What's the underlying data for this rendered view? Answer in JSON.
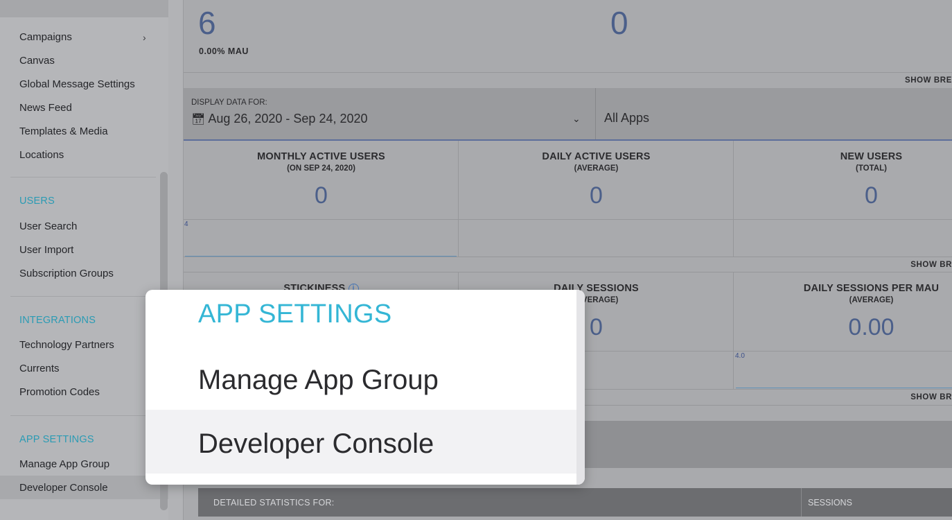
{
  "sidebar": {
    "items_top": [
      {
        "label": "Campaigns",
        "has_submenu": true
      },
      {
        "label": "Canvas"
      },
      {
        "label": "Global Message Settings"
      },
      {
        "label": "News Feed"
      },
      {
        "label": "Templates & Media"
      },
      {
        "label": "Locations"
      }
    ],
    "users_section": "USERS",
    "users_items": [
      "User Search",
      "User Import",
      "Subscription Groups"
    ],
    "integrations_section": "INTEGRATIONS",
    "integrations_items": [
      "Technology Partners",
      "Currents",
      "Promotion Codes"
    ],
    "app_settings_section": "APP SETTINGS",
    "app_settings_items": [
      "Manage App Group",
      "Developer Console"
    ],
    "active_item": "Developer Console",
    "accent_color": "#2a9bb4"
  },
  "top_stats": {
    "left_value": "6",
    "left_sub": "0.00% MAU",
    "right_value": "0",
    "show_breakdown": "SHOW BRE"
  },
  "filter": {
    "label": "DISPLAY DATA FOR:",
    "date_range": "Aug 26, 2020 - Sep 24, 2020",
    "apps": "All Apps"
  },
  "stats_row1": [
    {
      "title": "MONTHLY ACTIVE USERS",
      "sub": "(ON SEP 24, 2020)",
      "value": "0"
    },
    {
      "title": "DAILY ACTIVE USERS",
      "sub": "(AVERAGE)",
      "value": "0"
    },
    {
      "title": "NEW USERS",
      "sub": "(TOTAL)",
      "value": "0"
    }
  ],
  "row1_axis_tick": "4",
  "row1_show_breakdown": "SHOW BR",
  "stats_row2": [
    {
      "title": "STICKINESS",
      "sub": "",
      "value": ""
    },
    {
      "title": "DAILY SESSIONS",
      "sub": "(AVERAGE)",
      "value": "0"
    },
    {
      "title": "DAILY SESSIONS PER MAU",
      "sub": "(AVERAGE)",
      "value": "0.00"
    }
  ],
  "row2_axis_tick": "4.0",
  "row2_show_breakdown": "SHOW BR",
  "detail": {
    "label": "DETAILED STATISTICS FOR:",
    "sessions": "SESSIONS"
  },
  "popup": {
    "section": "APP SETTINGS",
    "items": [
      "Manage App Group",
      "Developer Console"
    ],
    "highlighted": "Developer Console",
    "section_color": "#34b6d5"
  }
}
